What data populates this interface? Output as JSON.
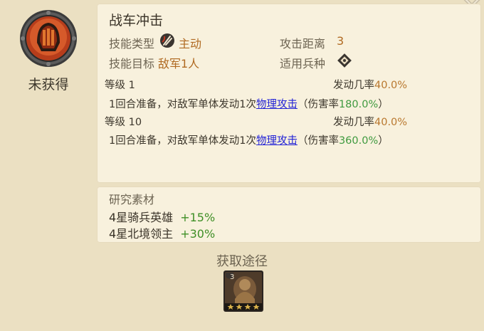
{
  "skill": {
    "name": "战车冲击",
    "status": "未获得",
    "type_label": "技能类型",
    "type_value": "主动",
    "target_label": "技能目标",
    "target_value": "敌军1人",
    "range_label": "攻击距离",
    "range_value": "3",
    "troop_label": "适用兵种"
  },
  "levels": [
    {
      "level_label": "等级 1",
      "rate_label": "发动几率",
      "rate_value": "40.0%",
      "desc_prefix": "1回合准备，对敌军单体发动1次",
      "desc_link": "物理攻击",
      "desc_mid": "（伤害率",
      "damage_value": "180.0%",
      "desc_suffix": "）"
    },
    {
      "level_label": "等级 10",
      "rate_label": "发动几率",
      "rate_value": "40.0%",
      "desc_prefix": "1回合准备，对敌军单体发动1次",
      "desc_link": "物理攻击",
      "desc_mid": "（伤害率",
      "damage_value": "360.0%",
      "desc_suffix": "）"
    }
  ],
  "research": {
    "title": "研究素材",
    "items": [
      {
        "name": "4星骑兵英雄",
        "bonus": "+15%"
      },
      {
        "name": "4星北境领主",
        "bonus": "+30%"
      }
    ]
  },
  "source": {
    "title": "获取途径",
    "items": [
      {
        "count": "3",
        "stars": 4
      }
    ]
  },
  "colors": {
    "accent_orange": "#b06a22",
    "bonus_green": "#3f9a3f",
    "link_blue": "#2323d6"
  }
}
